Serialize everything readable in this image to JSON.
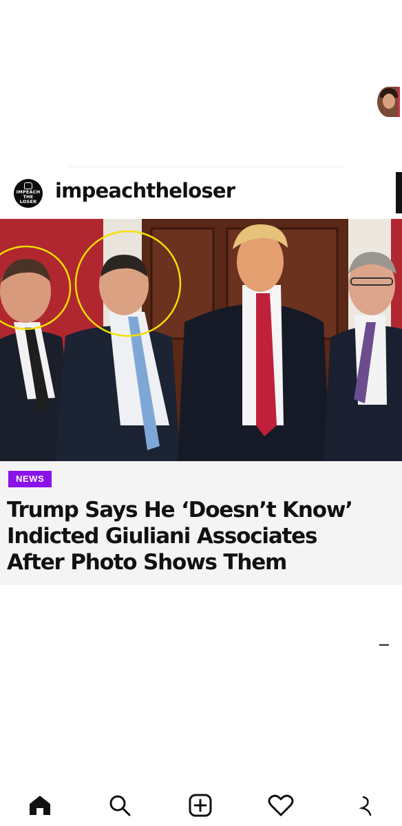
{
  "profile": {
    "username": "impeachtheloser",
    "avatar_text": [
      "IMPEACH",
      "THE",
      "LOSER"
    ]
  },
  "article": {
    "category": "NEWS",
    "headline_lines": [
      "Trump Says He ‘Doesn’t Know’",
      "Indicted Giuliani Associates",
      "After Photo Shows Them"
    ]
  },
  "colors": {
    "badge": "#8b12e8",
    "circle_highlight": "#f4e000",
    "story_ring": "#c8324e"
  },
  "nav": {
    "items": [
      {
        "icon": "home-icon",
        "active": true
      },
      {
        "icon": "search-icon",
        "active": false
      },
      {
        "icon": "add-post-icon",
        "active": false
      },
      {
        "icon": "heart-icon",
        "active": false
      },
      {
        "icon": "profile-icon",
        "active": false
      }
    ]
  }
}
